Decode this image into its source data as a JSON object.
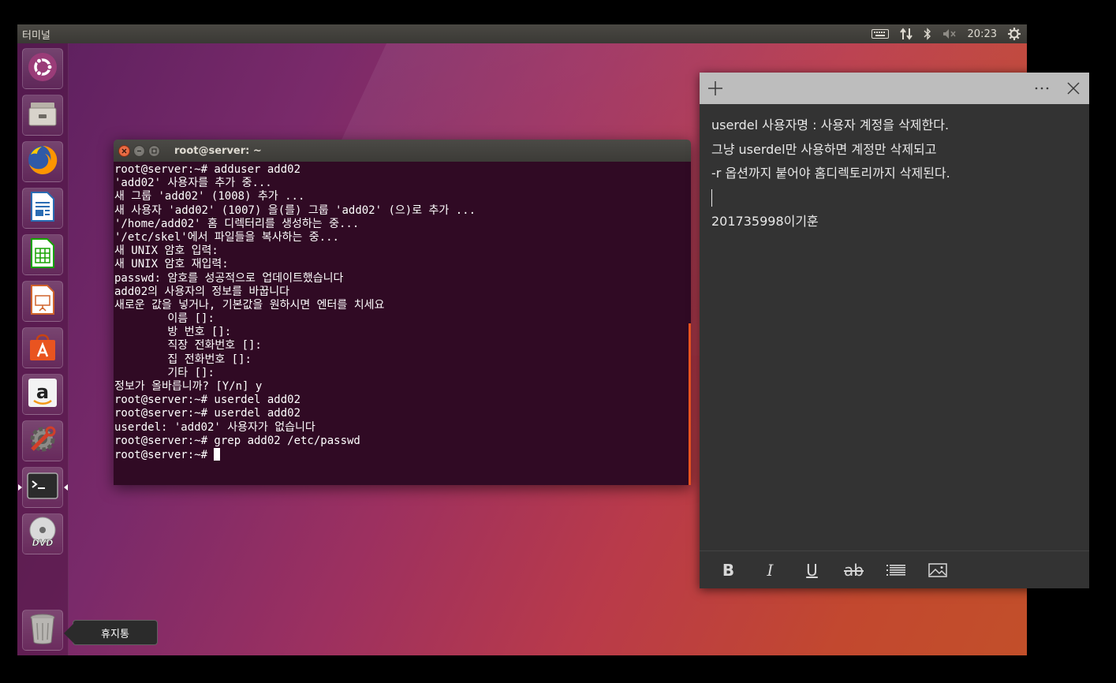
{
  "top_panel": {
    "title": "터미널",
    "clock": "20:23",
    "indicators": [
      "keyboard-icon",
      "network-arrows-icon",
      "bluetooth-icon",
      "volume-muted-icon",
      "gear-icon"
    ]
  },
  "launcher": {
    "items": [
      {
        "name": "ubuntu-dash",
        "icon": "ubuntu-logo-icon"
      },
      {
        "name": "files",
        "icon": "file-cabinet-icon"
      },
      {
        "name": "firefox",
        "icon": "firefox-icon"
      },
      {
        "name": "writer",
        "icon": "libreoffice-writer-icon"
      },
      {
        "name": "calc",
        "icon": "libreoffice-calc-icon"
      },
      {
        "name": "impress",
        "icon": "libreoffice-impress-icon"
      },
      {
        "name": "software",
        "icon": "shopping-bag-icon"
      },
      {
        "name": "amazon",
        "icon": "amazon-icon"
      },
      {
        "name": "settings",
        "icon": "wrench-gear-icon"
      },
      {
        "name": "terminal",
        "icon": "terminal-icon"
      },
      {
        "name": "dvd",
        "icon": "dvd-icon"
      },
      {
        "name": "trash",
        "icon": "trash-icon"
      }
    ],
    "trash_tooltip": "휴지통"
  },
  "terminal": {
    "title": "root@server: ~",
    "lines": [
      "root@server:~# adduser add02",
      "'add02' 사용자를 추가 중...",
      "새 그룹 'add02' (1008) 추가 ...",
      "새 사용자 'add02' (1007) 을(를) 그룹 'add02' (으)로 추가 ...",
      "'/home/add02' 홈 디렉터리를 생성하는 중...",
      "'/etc/skel'에서 파일들을 복사하는 중...",
      "새 UNIX 암호 입력:",
      "새 UNIX 암호 재입력:",
      "passwd: 암호를 성공적으로 업데이트했습니다",
      "add02의 사용자의 정보를 바꿉니다",
      "새로운 값을 넣거나, 기본값을 원하시면 엔터를 치세요",
      "        이름 []:",
      "        방 번호 []:",
      "        직장 전화번호 []:",
      "        집 전화번호 []:",
      "        기타 []:",
      "정보가 올바릅니까? [Y/n] y",
      "root@server:~# userdel add02",
      "root@server:~# userdel add02",
      "userdel: 'add02' 사용자가 없습니다",
      "root@server:~# grep add02 /etc/passwd",
      "root@server:~# "
    ]
  },
  "sticky_note": {
    "lines": [
      "userdel 사용자명 : 사용자 계정을 삭제한다.",
      "그냥 userdel만 사용하면 계정만 삭제되고",
      "-r 옵션까지 붙어야 홈디렉토리까지 삭제된다.",
      "",
      "201735998이기훈"
    ],
    "toolbar": {
      "bold": "B",
      "italic": "I",
      "underline": "U",
      "strikethrough": "ab"
    }
  },
  "colors": {
    "terminal_bg": "#300a24",
    "ubuntu_orange": "#e95420",
    "sticky_bg": "#333333",
    "sticky_header": "#bdbdbd"
  }
}
